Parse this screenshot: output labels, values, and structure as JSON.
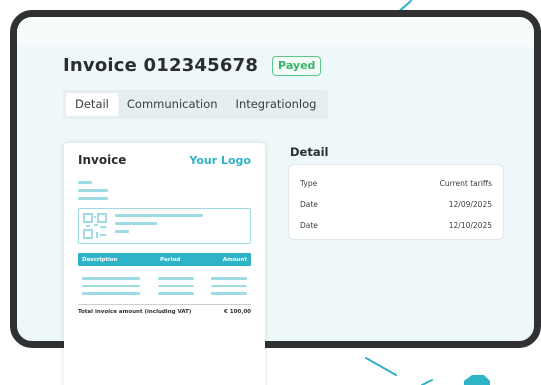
{
  "invoice": {
    "title": "Invoice 012345678",
    "status": "Payed"
  },
  "tabs": [
    {
      "label": "Detail"
    },
    {
      "label": "Communication"
    },
    {
      "label": "Integrationlog"
    }
  ],
  "detail": {
    "heading": "Detail",
    "rows": [
      {
        "label": "Type",
        "value": "Current tariffs"
      },
      {
        "label": "Date",
        "value": "12/09/2025"
      },
      {
        "label": "Date",
        "value": "12/10/2025"
      }
    ]
  },
  "document": {
    "title": "Invoice",
    "logo": "Your Logo",
    "columns": [
      "Description",
      "Period",
      "Amount"
    ],
    "total_label": "Total invoice amount (including VAT)",
    "total_value": "€ 100,00"
  },
  "colors": {
    "accent": "#2fb3c7",
    "status_green": "#39b56a",
    "frame": "#2f3133"
  }
}
